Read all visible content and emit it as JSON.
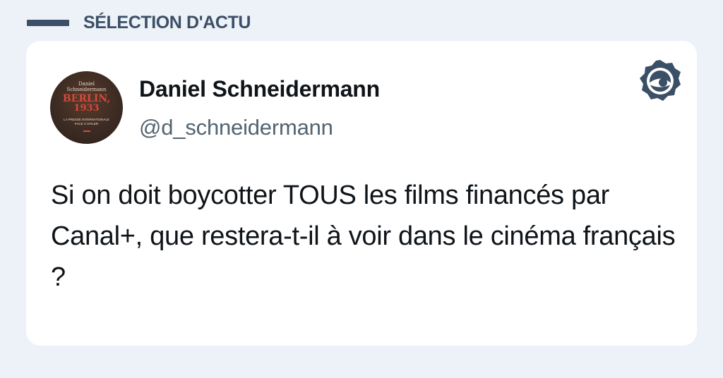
{
  "section": {
    "label": "SÉLECTION D'ACTU"
  },
  "tweet": {
    "display_name": "Daniel Schneidermann",
    "handle": "@d_schneidermann",
    "text": "Si on doit boycotter TOUS les films financés par Canal+, que restera-t-il à voir dans le cinéma français ?"
  },
  "avatar": {
    "line1": "Daniel",
    "line2": "Schneidermann",
    "title": "BERLIN,",
    "year": "1933",
    "sub1": "LA PRESSE INTERNATIONALE",
    "sub2": "FACE À HITLER"
  },
  "icons": {
    "brand": "eye-logo-icon"
  },
  "colors": {
    "background": "#edf1f8",
    "accent": "#3b4f66",
    "card": "#ffffff",
    "text": "#0f1419",
    "muted": "#536471"
  }
}
